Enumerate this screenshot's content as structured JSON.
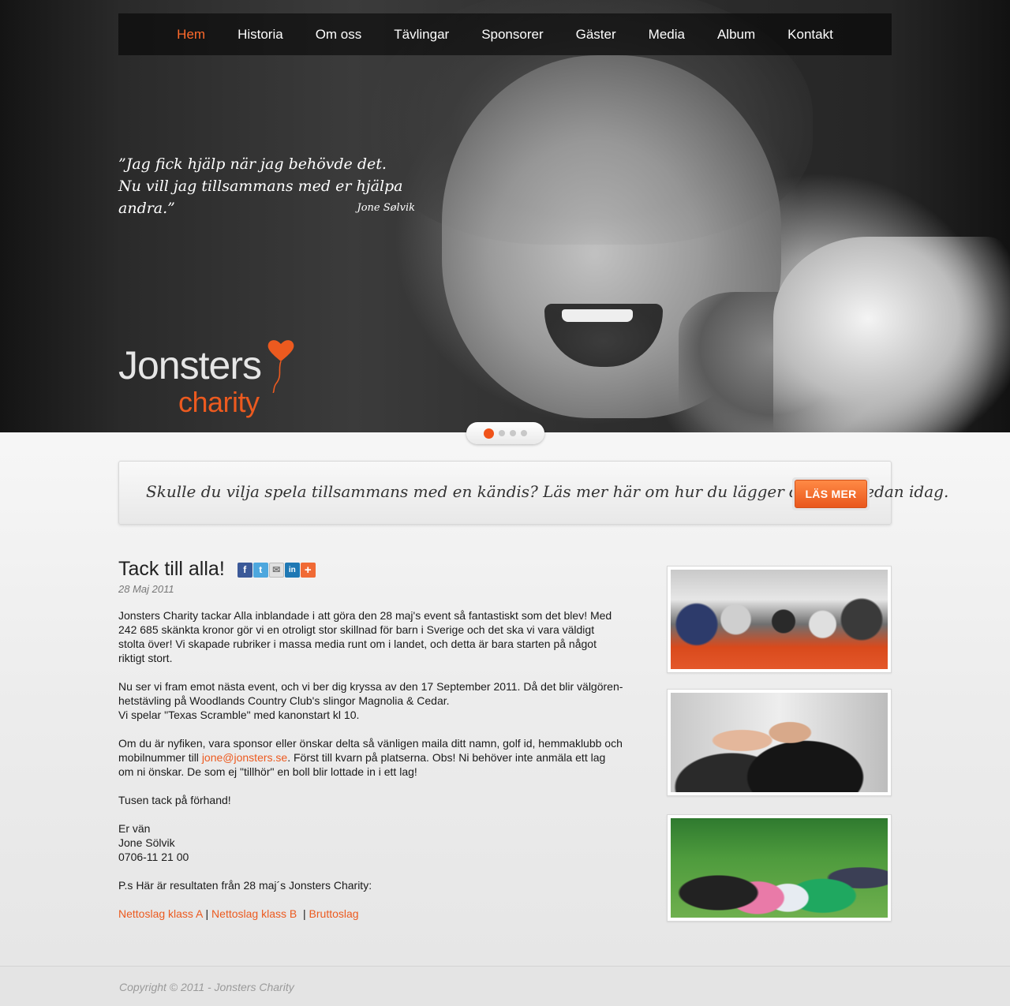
{
  "nav": {
    "items": [
      {
        "label": "Hem",
        "active": true
      },
      {
        "label": "Historia",
        "active": false
      },
      {
        "label": "Om oss",
        "active": false
      },
      {
        "label": "Tävlingar",
        "active": false
      },
      {
        "label": "Sponsorer",
        "active": false
      },
      {
        "label": "Gäster",
        "active": false
      },
      {
        "label": "Media",
        "active": false
      },
      {
        "label": "Album",
        "active": false
      },
      {
        "label": "Kontakt",
        "active": false
      }
    ]
  },
  "hero": {
    "quote_line1": "”Jag fick hjälp när jag behövde det.",
    "quote_line2": "Nu vill jag tillsammans med er hjälpa andra.”",
    "quote_author": "Jone Sølvik",
    "logo_word1": "Jonsters",
    "logo_word2": "charity",
    "slider": {
      "count": 4,
      "active_index": 0
    }
  },
  "promo": {
    "text": "Skulle du vilja spela tillsammans med en kändis? Läs mer här om hur du lägger ditt bud redan idag.",
    "button_label": "LÄS MER"
  },
  "article": {
    "title": "Tack till alla!",
    "date": "28 Maj 2011",
    "share_icons": [
      "facebook-icon",
      "twitter-icon",
      "email-icon",
      "linkedin-icon",
      "more-share-icon"
    ],
    "p1": "Jonsters Charity tackar Alla inblandade i att göra den 28 maj's event så fantastiskt som det blev! Med 242 685 skänkta kronor gör vi en otroligt stor skillnad för barn i Sverige och det ska vi vara väldigt stolta över! Vi skapade rubriker i massa media runt om i landet, och detta är bara starten på något riktigt stort.",
    "p2_line1": "Nu ser vi fram emot nästa event, och vi ber dig kryssa av den 17 September 2011. Då det blir välgören­hetstävling på Woodlands Country Club's slingor Magnolia & Cedar.",
    "p2_line2": "Vi spelar \"Texas Scramble\" med kanonstart kl 10.",
    "p3_before": "Om du är nyfiken, vara sponsor eller önskar delta så vänligen maila ditt namn, golf id, hemmaklubb och mobilnummer till ",
    "p3_email": "jone@jonsters.se",
    "p3_after": ". Först till kvarn på platserna. Obs! Ni behöver inte anmäla ett lag om ni önskar. De som ej \"tillhör\" en boll blir lottade in i ett lag!",
    "p4": "Tusen tack på förhand!",
    "sign_1": "Er vän",
    "sign_2": "Jone Sölvik",
    "sign_3": "0706-11 21 00",
    "ps": "P.s Här är resultaten från 28 maj´s Jonsters Charity:",
    "links": {
      "l1": "Nettoslag klass A",
      "l2": "Nettoslag klass B",
      "l3": "Bruttoslag",
      "sep": "|"
    }
  },
  "footer": {
    "copyright": "Copyright © 2011 - Jonsters Charity"
  },
  "colors": {
    "accent": "#ec5a1f",
    "nav_active": "#ff6a2b",
    "button": "#f07b38"
  }
}
